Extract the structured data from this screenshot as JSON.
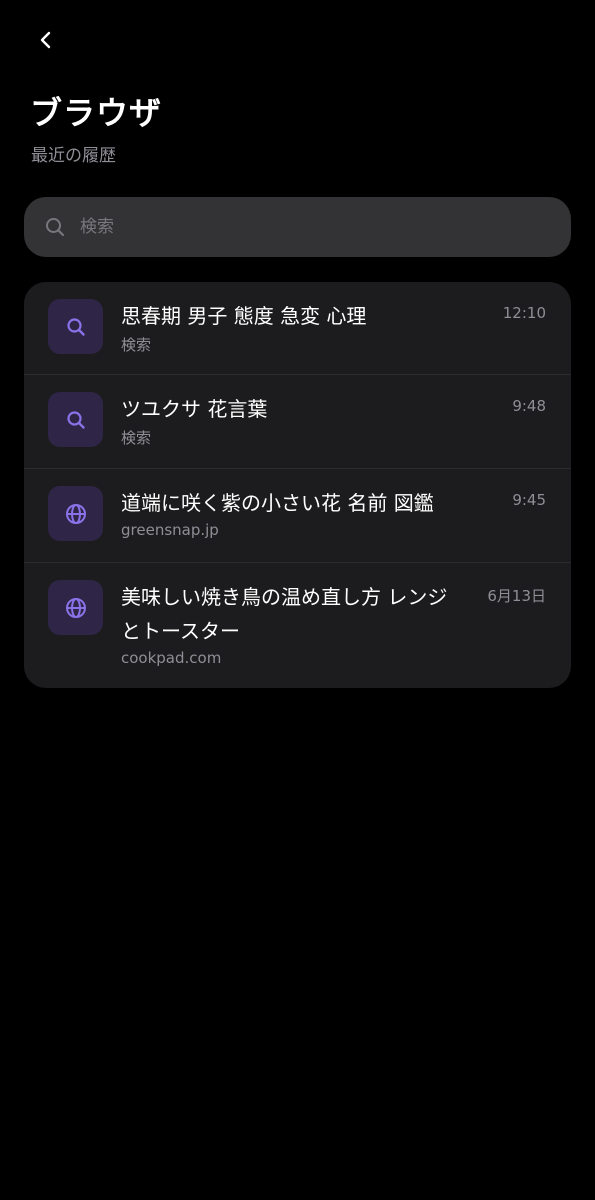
{
  "header": {
    "title": "ブラウザ",
    "subtitle": "最近の履歴"
  },
  "search": {
    "placeholder": "検索",
    "value": ""
  },
  "history": [
    {
      "title": "思春期 男子 態度 急変 心理",
      "subtitle": "検索",
      "time": "12:10",
      "icon": "search-icon"
    },
    {
      "title": "ツユクサ 花言葉",
      "subtitle": "検索",
      "time": "9:48",
      "icon": "search-icon"
    },
    {
      "title": "道端に咲く紫の小さい花 名前 図鑑",
      "subtitle": "greensnap.jp",
      "time": "9:45",
      "icon": "globe-icon"
    },
    {
      "title": "美味しい焼き鳥の温め直し方 レンジとトースター",
      "subtitle": "cookpad.com",
      "time": "6月13日",
      "icon": "globe-icon"
    }
  ],
  "colors": {
    "background": "#000000",
    "card": "#1c1c1e",
    "search_bar": "#333335",
    "icon_tile": "#2e2547",
    "accent": "#8a72e8",
    "secondary_text": "#8e8e96"
  }
}
